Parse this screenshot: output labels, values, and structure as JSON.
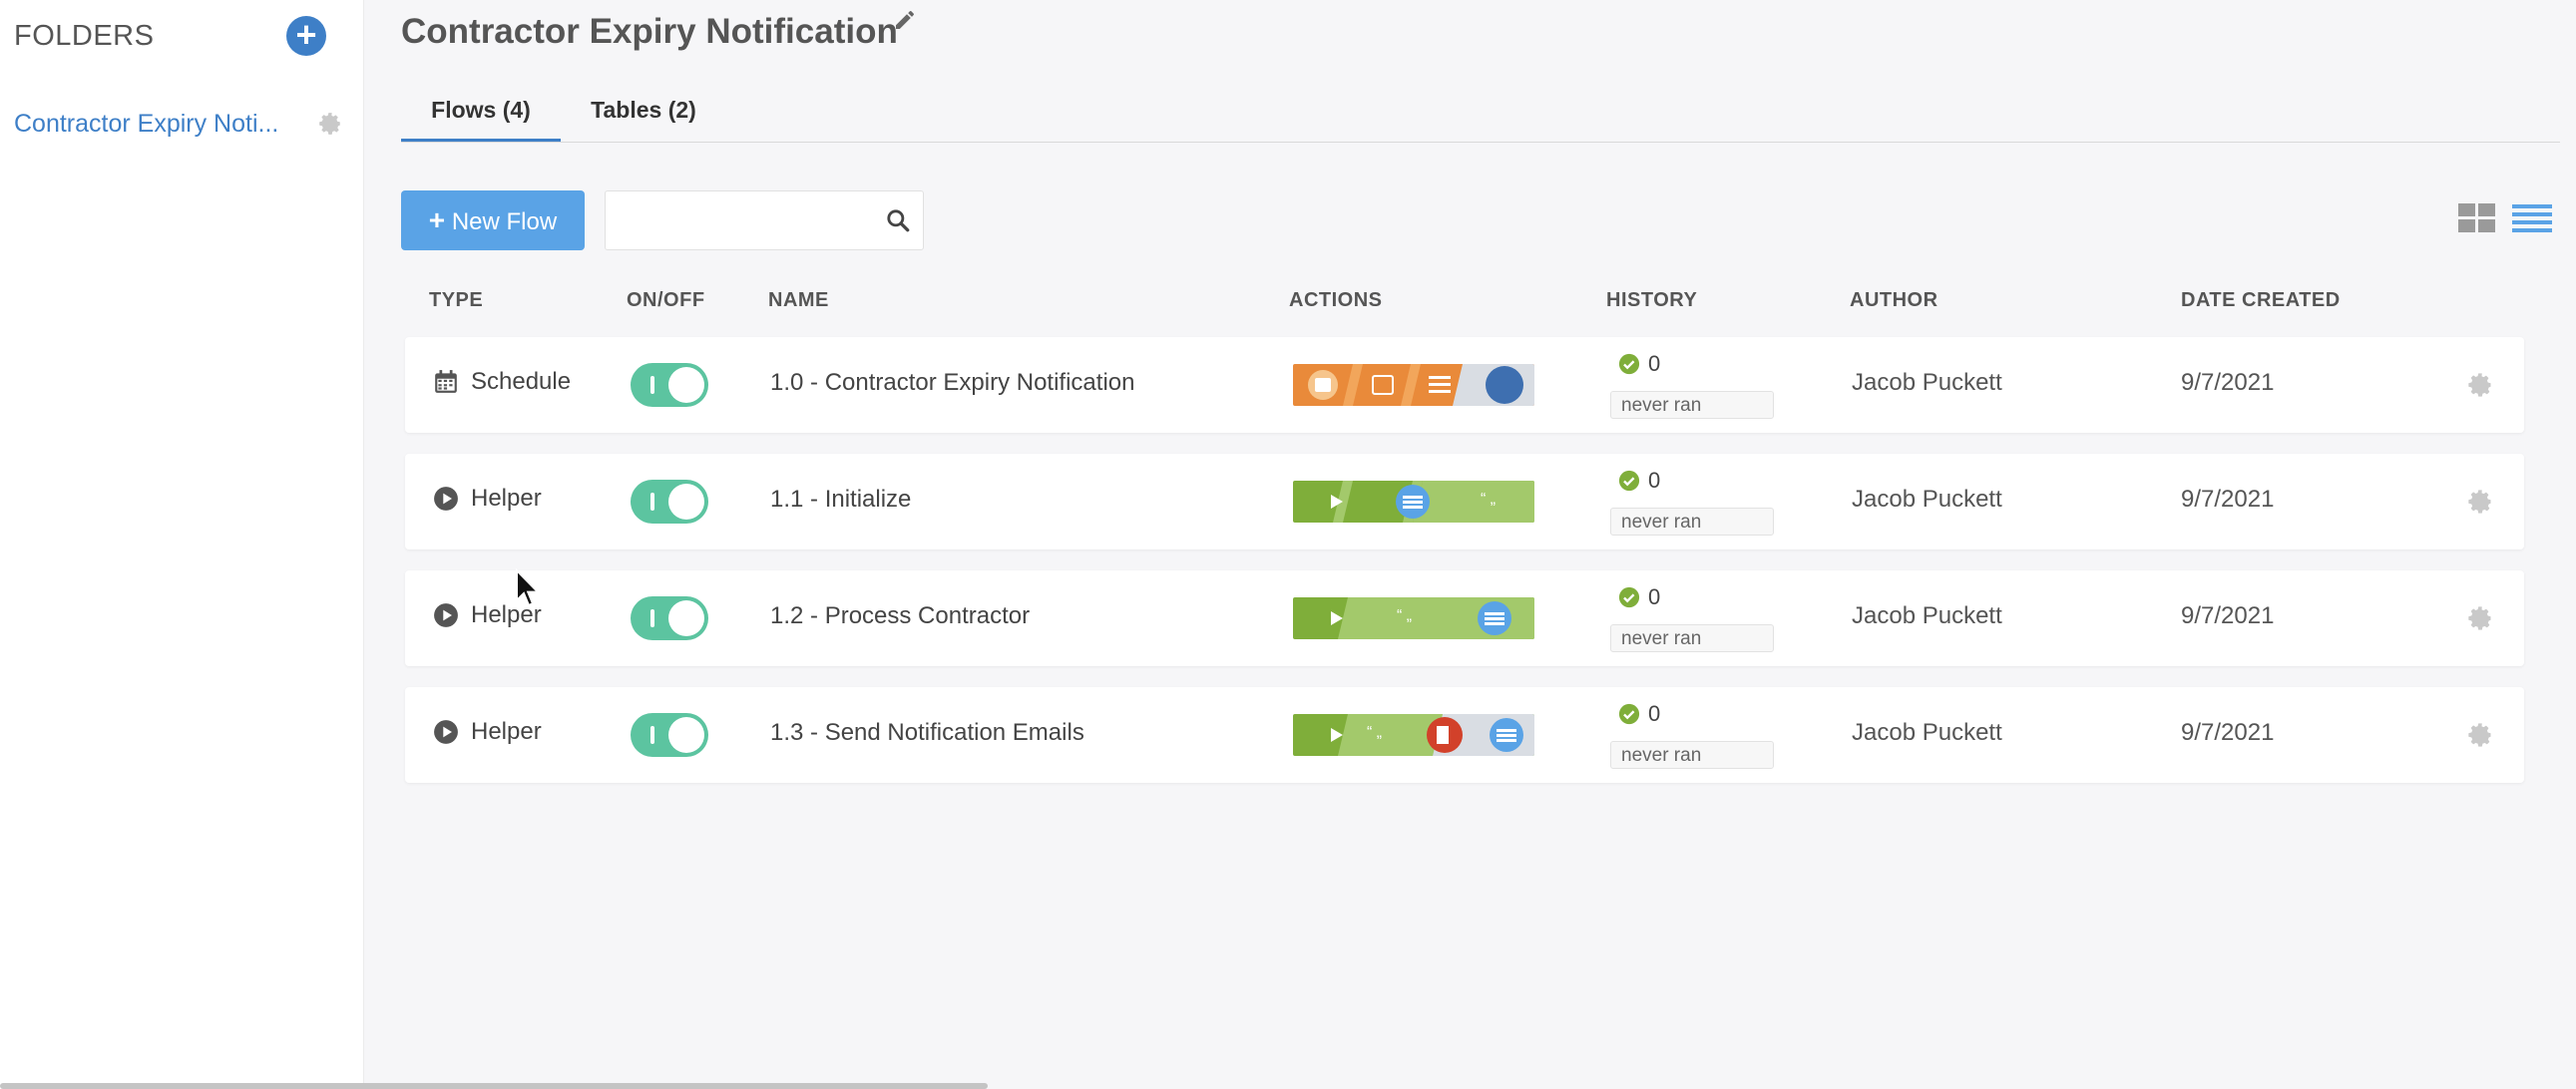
{
  "sidebar": {
    "heading": "FOLDERS",
    "add_icon": "plus-circle-icon",
    "folders": [
      {
        "label": "Contractor Expiry Noti...",
        "icon": "gear-icon"
      }
    ]
  },
  "page": {
    "title": "Contractor Expiry Notification",
    "edit_icon": "pencil-icon"
  },
  "tabs": [
    {
      "label": "Flows (4)",
      "active": true
    },
    {
      "label": "Tables (2)",
      "active": false
    }
  ],
  "toolbar": {
    "new_flow_label": "New Flow",
    "search_value": "",
    "search_placeholder": "",
    "view_icons": [
      "grid-view-icon",
      "list-view-icon"
    ],
    "active_view": "list"
  },
  "table": {
    "columns": [
      "TYPE",
      "ON/OFF",
      "NAME",
      "ACTIONS",
      "HISTORY",
      "AUTHOR",
      "DATE CREATED"
    ],
    "rows": [
      {
        "type": "Schedule",
        "type_icon": "calendar-icon",
        "on": true,
        "name": "1.0 - Contractor Expiry Notification",
        "history_count": "0",
        "history_status": "never ran",
        "author": "Jacob Puckett",
        "date_created": "9/7/2021"
      },
      {
        "type": "Helper",
        "type_icon": "play-circle-icon",
        "on": true,
        "name": "1.1 - Initialize",
        "history_count": "0",
        "history_status": "never ran",
        "author": "Jacob Puckett",
        "date_created": "9/7/2021"
      },
      {
        "type": "Helper",
        "type_icon": "play-circle-icon",
        "on": true,
        "name": "1.2 - Process Contractor",
        "history_count": "0",
        "history_status": "never ran",
        "author": "Jacob Puckett",
        "date_created": "9/7/2021"
      },
      {
        "type": "Helper",
        "type_icon": "play-circle-icon",
        "on": true,
        "name": "1.3 - Send Notification Emails",
        "history_count": "0",
        "history_status": "never ran",
        "author": "Jacob Puckett",
        "date_created": "9/7/2021"
      }
    ]
  },
  "colors": {
    "accent": "#3e7fc7",
    "button": "#5aa3e6",
    "toggle_on": "#5cc4a0",
    "history_ok": "#7fae3a",
    "strip_orange": "#e98a3a",
    "strip_green": "#7fae3a"
  }
}
